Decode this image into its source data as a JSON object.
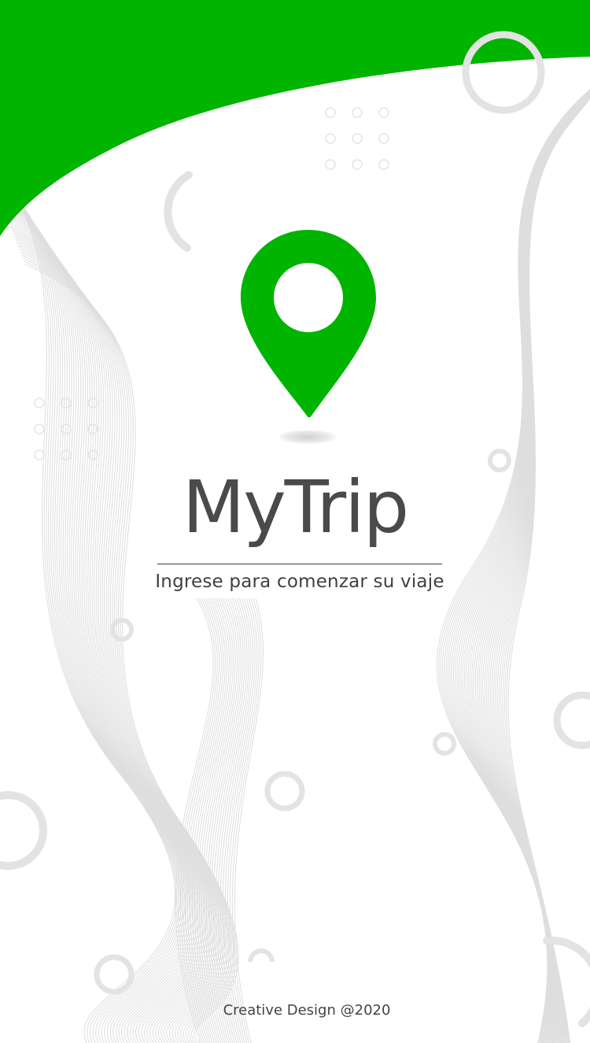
{
  "app": {
    "title": "MyTrip",
    "subtitle": "Ingrese para comenzar su viaje",
    "footer": "Creative Design @2020"
  },
  "logo": {
    "icon": "map-pin-icon"
  },
  "colors": {
    "brand_green": "#00b400",
    "title_gray": "#4a4a4a",
    "decoration_gray": "#e2e2e2",
    "background": "#ffffff"
  }
}
